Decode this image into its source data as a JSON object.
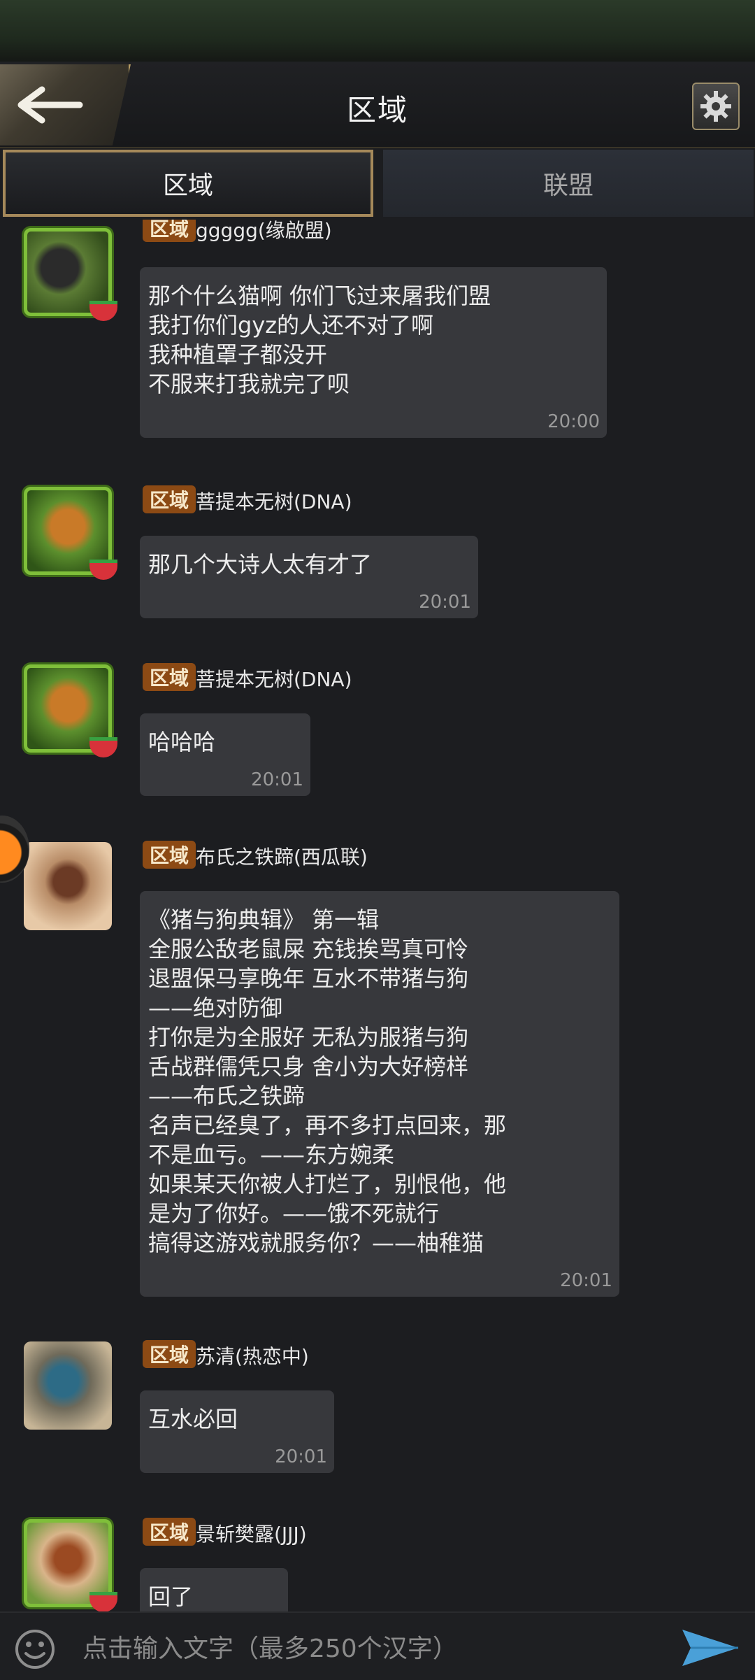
{
  "header": {
    "title": "区域"
  },
  "tabs": [
    {
      "label": "区域",
      "active": true
    },
    {
      "label": "联盟",
      "active": false
    }
  ],
  "messages": [
    {
      "tag": "区域",
      "username": "ggggg(缘啟盟)",
      "text": "那个什么猫啊 你们飞过来屠我们盟\n我打你们gyz的人还不对了啊\n我种植罩子都没开\n不服来打我就完了呗",
      "time": "20:00"
    },
    {
      "tag": "区域",
      "username": "菩提本无树(DNA)",
      "text": "那几个大诗人太有才了",
      "time": "20:01"
    },
    {
      "tag": "区域",
      "username": "菩提本无树(DNA)",
      "text": "哈哈哈",
      "time": "20:01"
    },
    {
      "tag": "区域",
      "username": "布氏之铁蹄(西瓜联)",
      "text": "《猪与狗典辑》 第一辑\n全服公敌老鼠屎 充钱挨骂真可怜\n退盟保马享晚年 互水不带猪与狗\n——绝对防御\n打你是为全服好 无私为服猪与狗\n舌战群儒凭只身 舍小为大好榜样\n——布氏之铁蹄\n名声已经臭了，再不多打点回来，那\n不是血亏。——东方婉柔\n如果某天你被人打烂了，别恨他，他\n是为了你好。——饿不死就行\n搞得这游戏就服务你？——柚稚猫",
      "time": "20:01"
    },
    {
      "tag": "区域",
      "username": "苏清(热恋中)",
      "text": "互水必回",
      "time": "20:01"
    },
    {
      "tag": "区域",
      "username": "景斩樊露(JJJ)",
      "text": "回了",
      "time": ""
    }
  ],
  "input": {
    "placeholder": "点击输入文字（最多250个汉字）"
  },
  "icons": {
    "back": "back-arrow-icon",
    "settings": "gear-icon",
    "emoji": "smiley-icon",
    "send": "send-icon"
  }
}
